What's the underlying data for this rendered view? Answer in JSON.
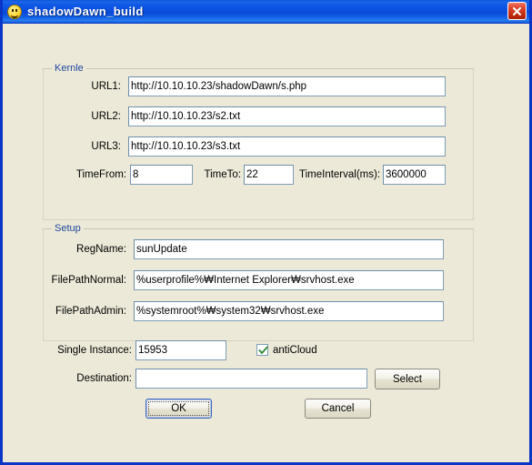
{
  "window": {
    "title": "shadowDawn_build",
    "icon": "smiley-face-icon",
    "close_label": "×",
    "accent_title_color": "#0b4fe0",
    "client_background": "#ece9d8",
    "close_button_color": "#c32b12"
  },
  "kernle": {
    "group_label": "Kernle",
    "fields": [
      {
        "label": "URL1:",
        "value": "http://10.10.10.23/shadowDawn/s.php"
      },
      {
        "label": "URL2:",
        "value": "http://10.10.10.23/s2.txt"
      },
      {
        "label": "URL3:",
        "value": "http://10.10.10.23/s3.txt"
      }
    ],
    "time_from": {
      "label": "TimeFrom:",
      "value": "8"
    },
    "time_to": {
      "label": "TimeTo:",
      "value": "22"
    },
    "time_interval": {
      "label": "TimeInterval(ms):",
      "value": "3600000"
    }
  },
  "setup": {
    "group_label": "Setup",
    "fields": [
      {
        "label": "RegName:",
        "value": "sunUpdate"
      },
      {
        "label": "FilePathNormal:",
        "value": "%userprofile%₩Internet Explorer₩srvhost.exe"
      },
      {
        "label": "FilePathAdmin:",
        "value": "%systemroot%₩system32₩srvhost.exe"
      }
    ]
  },
  "options": {
    "single_instance": {
      "label": "Single Instance:",
      "value": "15953"
    },
    "anti_cloud": {
      "label": "antiCloud",
      "checked": true,
      "check_color": "#2e8b2e"
    },
    "destination": {
      "label": "Destination:",
      "value": "",
      "placeholder": ""
    },
    "select_button": "Select"
  },
  "buttons": {
    "ok": "OK",
    "cancel": "Cancel"
  }
}
